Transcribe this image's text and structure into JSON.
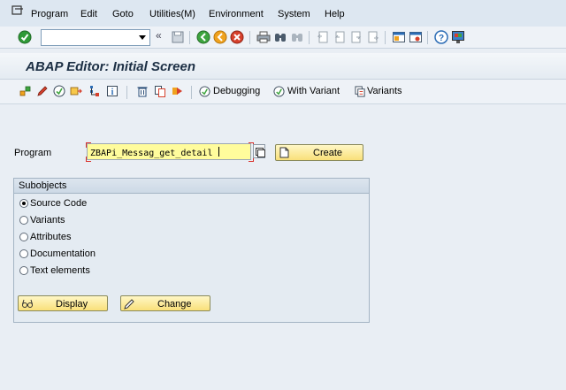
{
  "menubar": {
    "items": [
      "Program",
      "Edit",
      "Goto",
      "Utilities(M)",
      "Environment",
      "System",
      "Help"
    ]
  },
  "system_toolbar": {
    "command_value": "",
    "icons": [
      "enter-icon",
      "back-nav-icon",
      "save-icon",
      "back-icon",
      "exit-icon",
      "cancel-icon",
      "print-icon",
      "find-icon",
      "find-next-icon",
      "first-page-icon",
      "previous-page-icon",
      "next-page-icon",
      "last-page-icon",
      "new-session-icon",
      "shortcut-icon",
      "help-icon",
      "customize-layout-icon"
    ]
  },
  "title": "ABAP Editor: Initial Screen",
  "app_toolbar": {
    "debugging_label": "Debugging",
    "with_variant_label": "With Variant",
    "variants_label": "Variants"
  },
  "form": {
    "program_label": "Program",
    "program_value": "ZBAPi_Messag_get_detail",
    "create_label": "Create"
  },
  "subobjects": {
    "title": "Subobjects",
    "options": [
      {
        "label": "Source Code",
        "selected": true
      },
      {
        "label": "Variants",
        "selected": false
      },
      {
        "label": "Attributes",
        "selected": false
      },
      {
        "label": "Documentation",
        "selected": false
      },
      {
        "label": "Text elements",
        "selected": false
      }
    ],
    "display_label": "Display",
    "change_label": "Change"
  },
  "colors": {
    "input_highlight": "#fffc9c",
    "button_yellow": "#f9e07a",
    "background": "#e9eef4"
  }
}
